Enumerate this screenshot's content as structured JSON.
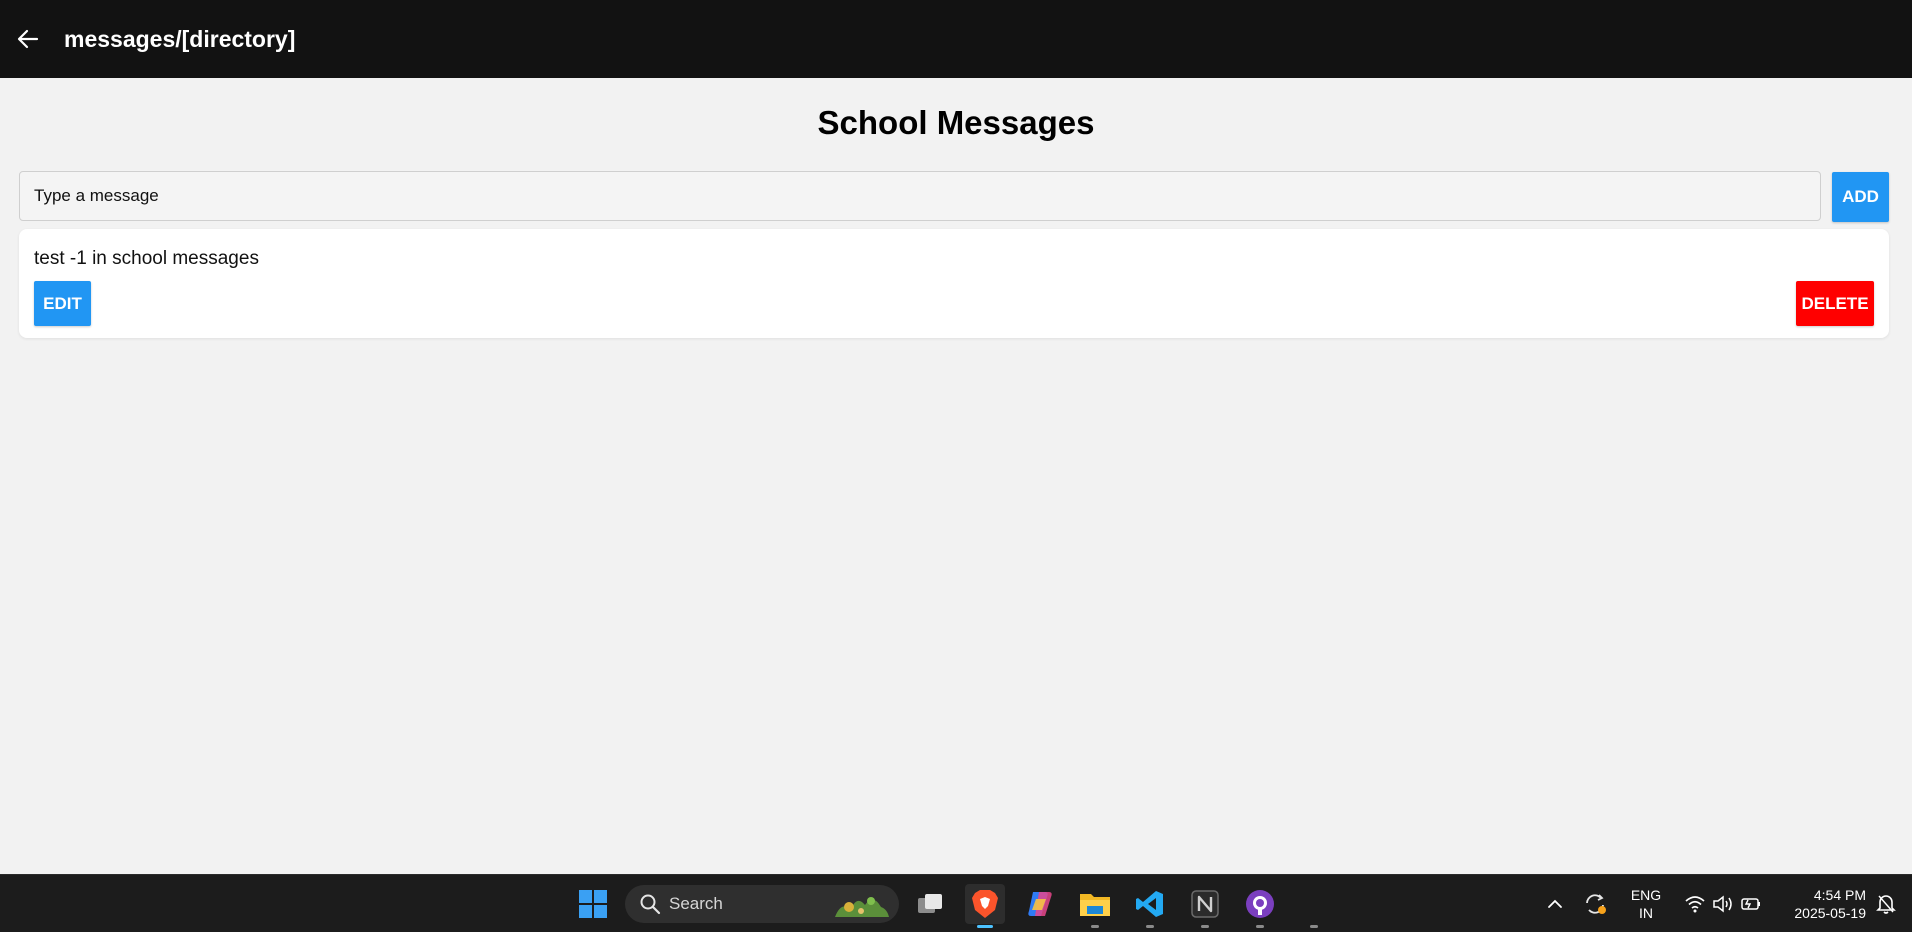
{
  "header": {
    "title": "messages/[directory]",
    "back_icon": "arrow-left-icon"
  },
  "page": {
    "title": "School Messages"
  },
  "composer": {
    "placeholder": "Type a message",
    "value": "",
    "add_label": "ADD"
  },
  "messages": [
    {
      "text": "test -1 in school messages",
      "edit_label": "EDIT",
      "delete_label": "DELETE"
    }
  ],
  "colors": {
    "header_bg": "#121212",
    "primary": "#2196f3",
    "danger": "#ff0000",
    "background": "#f2f2f2"
  },
  "taskbar": {
    "search_label": "Search",
    "apps": [
      "start-icon",
      "task-view-icon",
      "brave-browser-icon",
      "copilot-icon",
      "file-explorer-icon",
      "vscode-icon",
      "notion-icon",
      "github-desktop-icon"
    ],
    "language": {
      "line1": "ENG",
      "line2": "IN"
    },
    "clock": {
      "time": "4:54 PM",
      "date": "2025-05-19"
    }
  }
}
